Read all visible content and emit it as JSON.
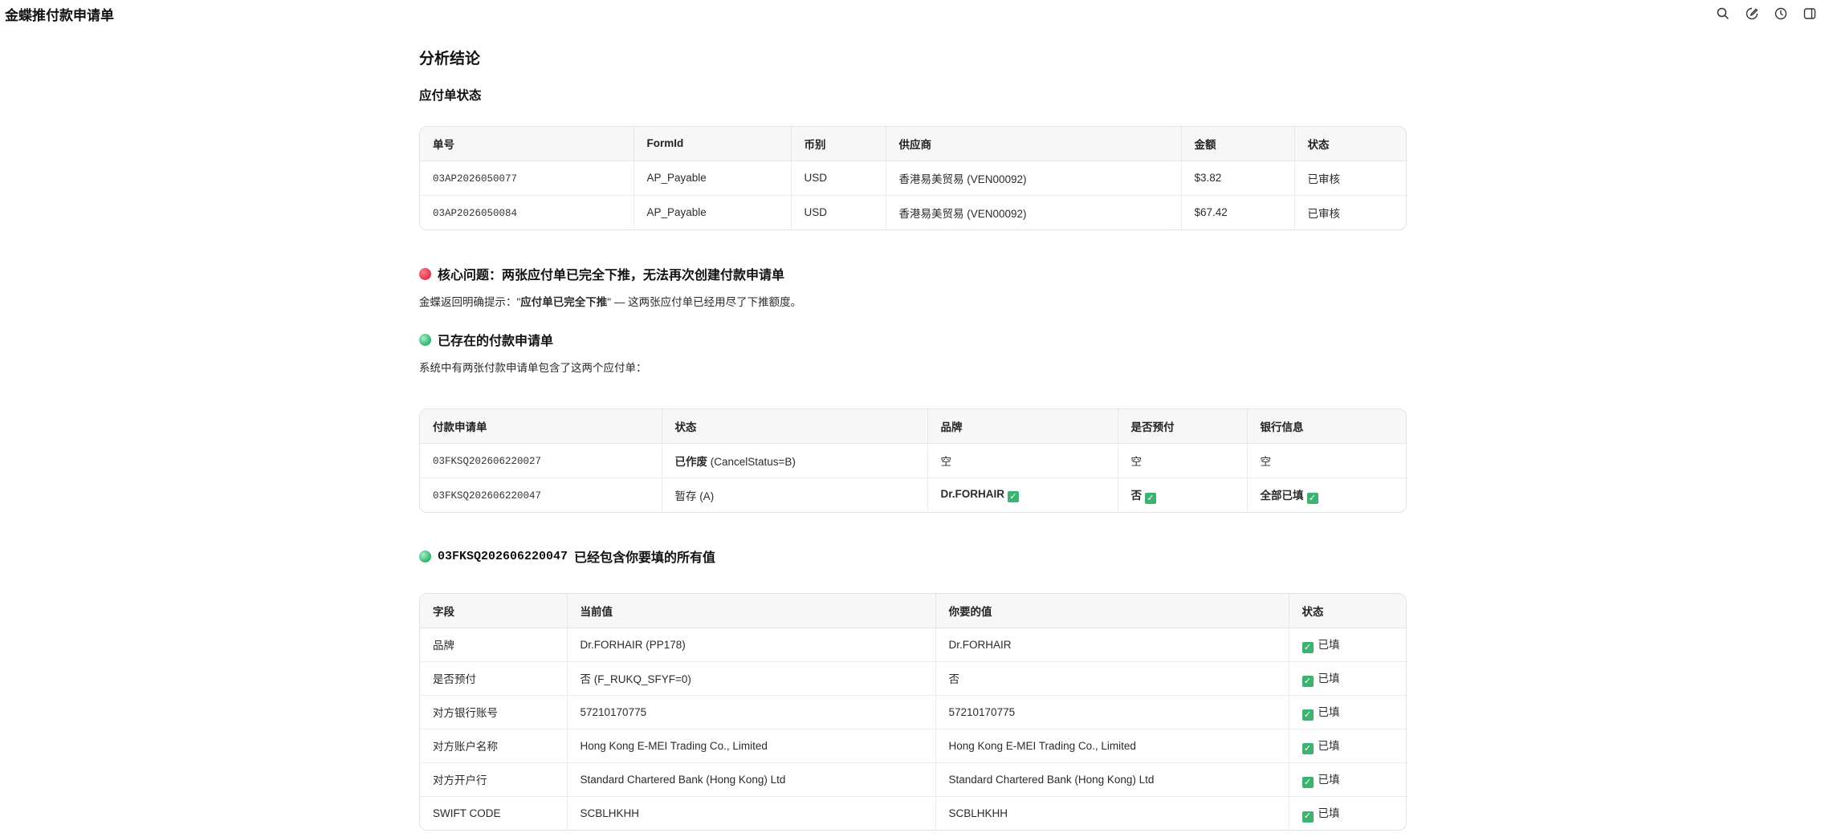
{
  "app": {
    "title": "金蝶推付款申请单"
  },
  "header": {
    "analysis_title": "分析结论",
    "payables_title": "应付单状态"
  },
  "payables": {
    "columns": [
      "单号",
      "FormId",
      "币别",
      "供应商",
      "金额",
      "状态"
    ],
    "rows": [
      [
        "03AP2026050077",
        "AP_Payable",
        "USD",
        "香港易美贸易 (VEN00092)",
        "$3.82",
        "已审核"
      ],
      [
        "03AP2026050084",
        "AP_Payable",
        "USD",
        "香港易美贸易 (VEN00092)",
        "$67.42",
        "已审核"
      ]
    ]
  },
  "core_issue": {
    "heading": "核心问题：两张应付单已完全下推，无法再次创建付款申请单",
    "text_prefix": "金蝶返回明确提示：\"",
    "text_bold": "应付单已完全下推",
    "text_suffix": "\" — 这两张应付单已经用尽了下推额度。"
  },
  "existing": {
    "heading": "已存在的付款申请单",
    "text": "系统中有两张付款申请单包含了这两个应付单：",
    "columns": [
      "付款申请单",
      "状态",
      "品牌",
      "是否预付",
      "银行信息"
    ],
    "rows": [
      {
        "id": "03FKSQ202606220027",
        "status_bold": "已作废",
        "status_rest": " (CancelStatus=B)",
        "brand": "空",
        "prepay": "空",
        "bank": "空"
      },
      {
        "id": "03FKSQ202606220047",
        "status_bold": "",
        "status_rest": "暂存 (A)",
        "brand": "Dr.FORHAIR",
        "prepay": "否",
        "bank": "全部已填"
      }
    ]
  },
  "contains": {
    "heading_id": "03FKSQ202606220047",
    "heading_text": " 已经包含你要填的所有值",
    "columns": [
      "字段",
      "当前值",
      "你要的值",
      "状态"
    ],
    "rows": [
      [
        "品牌",
        "Dr.FORHAIR (PP178)",
        "Dr.FORHAIR",
        "已填"
      ],
      [
        "是否预付",
        "否 (F_RUKQ_SFYF=0)",
        "否",
        "已填"
      ],
      [
        "对方银行账号",
        "57210170775",
        "57210170775",
        "已填"
      ],
      [
        "对方账户名称",
        "Hong Kong E-MEI Trading Co., Limited",
        "Hong Kong E-MEI Trading Co., Limited",
        "已填"
      ],
      [
        "对方开户行",
        "Standard Chartered Bank (Hong Kong) Ltd",
        "Standard Chartered Bank (Hong Kong) Ltd",
        "已填"
      ],
      [
        "SWIFT CODE",
        "SCBLHKHH",
        "SCBLHKHH",
        "已填"
      ]
    ]
  },
  "icons": [
    "search-icon",
    "edit-icon",
    "history-icon",
    "panel-icon",
    "check-icon"
  ],
  "colors": {
    "check": "#3cb371",
    "red_dot": "#e0344b",
    "green_dot": "#32b06b"
  }
}
